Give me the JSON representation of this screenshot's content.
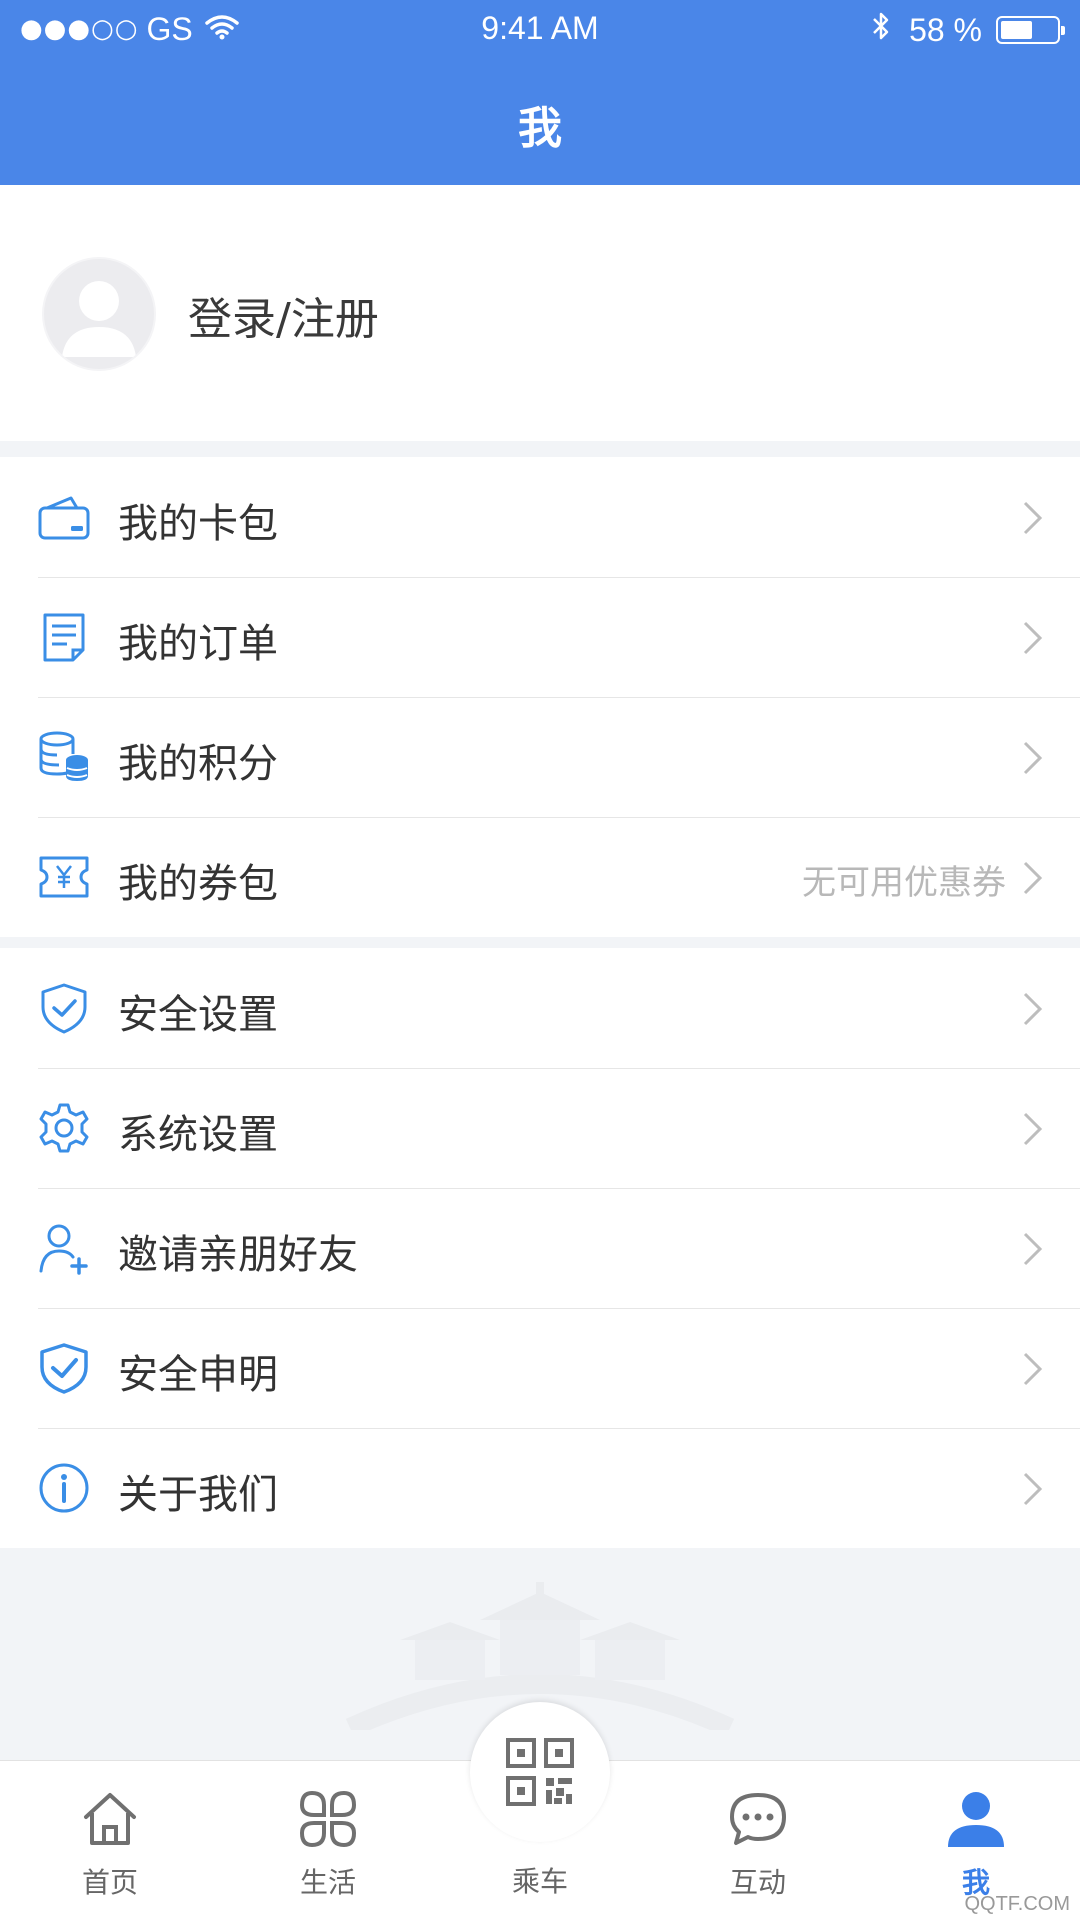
{
  "status_bar": {
    "signal": "●●●○○",
    "carrier": "GS",
    "time": "9:41 AM",
    "battery_text": "58 %",
    "battery_level": 0.58
  },
  "header": {
    "title": "我"
  },
  "profile": {
    "login_label": "登录/注册"
  },
  "section1": [
    {
      "label": "我的卡包",
      "icon": "wallet-icon"
    },
    {
      "label": "我的订单",
      "icon": "order-icon"
    },
    {
      "label": "我的积分",
      "icon": "points-icon"
    },
    {
      "label": "我的券包",
      "icon": "coupon-icon",
      "hint": "无可用优惠券"
    }
  ],
  "section2": [
    {
      "label": "安全设置",
      "icon": "shield-check-icon"
    },
    {
      "label": "系统设置",
      "icon": "gear-icon"
    },
    {
      "label": "邀请亲朋好友",
      "icon": "add-user-icon"
    },
    {
      "label": "安全申明",
      "icon": "shield-icon"
    },
    {
      "label": "关于我们",
      "icon": "info-icon"
    }
  ],
  "tabbar": {
    "home": "首页",
    "life": "生活",
    "ride": "乘车",
    "interact": "互动",
    "me": "我"
  },
  "watermark_text": "QQTF.COM",
  "colors": {
    "primary": "#4a86e8",
    "icon_blue": "#3a8ee6",
    "active_tab": "#3b7fe8"
  }
}
